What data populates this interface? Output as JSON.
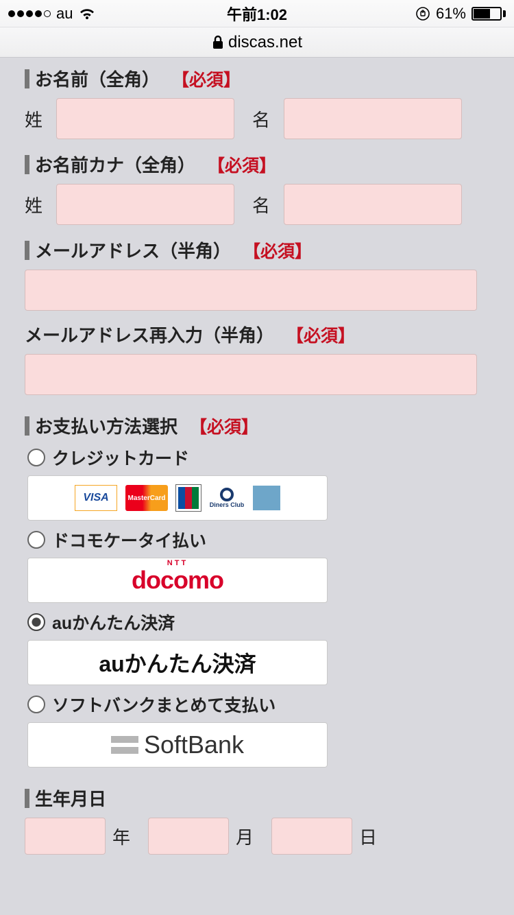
{
  "status": {
    "carrier": "au",
    "time": "午前1:02",
    "battery_pct": "61%"
  },
  "url": "discas.net",
  "sections": {
    "name": {
      "title": "お名前（全角）",
      "required": "【必須】",
      "last": "姓",
      "first": "名"
    },
    "kana": {
      "title": "お名前カナ（全角）",
      "required": "【必須】",
      "last": "姓",
      "first": "名"
    },
    "mail": {
      "title": "メールアドレス（半角）",
      "required": "【必須】"
    },
    "mail2": {
      "title": "メールアドレス再入力（半角）",
      "required": "【必須】"
    },
    "pay": {
      "title": "お支払い方法選択",
      "required": "【必須】"
    },
    "bd": {
      "title": "生年月日",
      "year": "年",
      "month": "月",
      "day": "日"
    }
  },
  "payment": {
    "options": [
      {
        "label": "クレジットカード",
        "selected": false,
        "logo": "cards"
      },
      {
        "label": "ドコモケータイ払い",
        "selected": false,
        "logo": "docomo"
      },
      {
        "label": "auかんたん決済",
        "selected": true,
        "logo": "au"
      },
      {
        "label": "ソフトバンクまとめて支払い",
        "selected": false,
        "logo": "softbank"
      }
    ],
    "logos": {
      "visa": "VISA",
      "mc": "MasterCard",
      "docomo_ntt": "NTT",
      "docomo": "docomo",
      "au": "auかんたん決済",
      "softbank": "SoftBank",
      "diners": "Diners Club"
    }
  }
}
